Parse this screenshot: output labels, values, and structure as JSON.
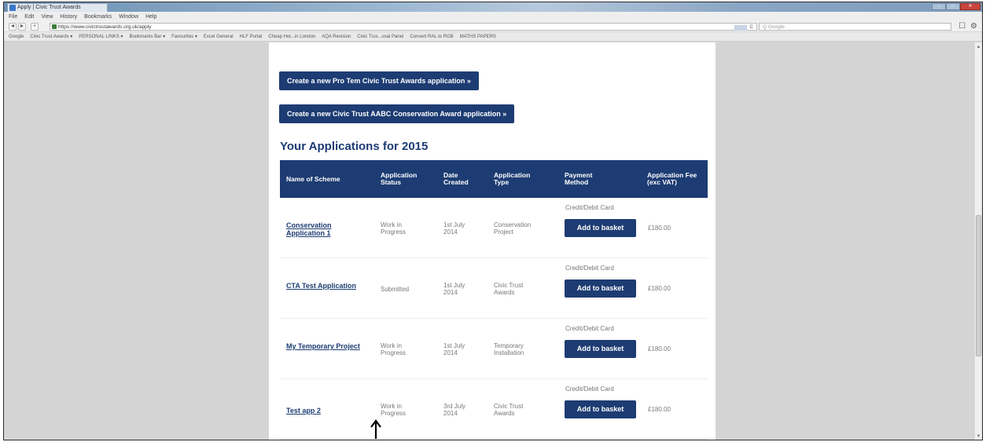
{
  "window": {
    "tab_title": "Apply | Civic Trust Awards",
    "controls": [
      "–",
      "□",
      "✕"
    ]
  },
  "menubar": [
    "File",
    "Edit",
    "View",
    "History",
    "Bookmarks",
    "Window",
    "Help"
  ],
  "navbar": {
    "back": "◄",
    "forward": "►",
    "plus": "+",
    "url": "https://www.civictrustawards.org.uk/apply",
    "search_placeholder": "Google",
    "search_icon": "Q",
    "reload": "C",
    "page_icon": "☐",
    "gear_icon": "⚙"
  },
  "bookmarks": [
    "Google",
    "Civic Trust Awards ▾",
    "PERSONAL LINKS ▾",
    "Bookmarks Bar ▾",
    "Favourites ▾",
    "Excel General",
    "HLF Portal",
    "Cheap Hot...in London",
    "AQA Revision",
    "Civic Trus...ssal Panel",
    "Convert RAL to RGB",
    "MATHS PAPERS"
  ],
  "actions": {
    "pro_tem": "Create a new Pro Tem Civic Trust Awards application »",
    "aabc": "Create a new Civic Trust AABC Conservation Award application »"
  },
  "applications": {
    "heading": "Your Applications for 2015",
    "columns": [
      "Name of Scheme",
      "Application Status",
      "Date Created",
      "Application Type",
      "Payment Method",
      "Application Fee (exc VAT)"
    ],
    "rows": [
      {
        "name": "Conservation Application 1",
        "status": "Work in Progress",
        "date": "1st July 2014",
        "type": "Conservation Project",
        "payment": "Credit/Debit Card",
        "button": "Add to basket",
        "fee": "£180.00"
      },
      {
        "name": "CTA Test Application",
        "status": "Submitted",
        "date": "1st July 2014",
        "type": "Civic Trust Awards",
        "payment": "Credit/Debit Card",
        "button": "Add to basket",
        "fee": "£180.00"
      },
      {
        "name": "My Temporary Project",
        "status": "Work in Progress",
        "date": "1st July 2014",
        "type": "Temporary Installation",
        "payment": "Credit/Debit Card",
        "button": "Add to basket",
        "fee": "£180.00"
      },
      {
        "name": "Test app 2",
        "status": "Work in Progress",
        "date": "3rd July 2014",
        "type": "Civic Trust Awards",
        "payment": "Credit/Debit Card",
        "button": "Add to basket",
        "fee": "£180.00"
      }
    ]
  },
  "colors": {
    "brand_navy": "#1d3c73",
    "gutter_grey": "#d4d4d4"
  }
}
